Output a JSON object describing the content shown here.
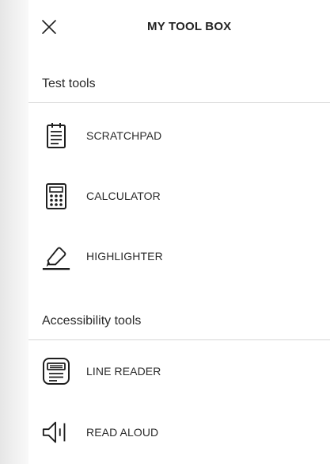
{
  "header": {
    "title": "MY TOOL BOX",
    "close_icon": "close-icon"
  },
  "sections": [
    {
      "heading": "Test tools",
      "items": [
        {
          "label": "SCRATCHPAD",
          "icon": "scratchpad-icon"
        },
        {
          "label": "CALCULATOR",
          "icon": "calculator-icon"
        },
        {
          "label": "HIGHLIGHTER",
          "icon": "highlighter-icon"
        }
      ]
    },
    {
      "heading": "Accessibility tools",
      "items": [
        {
          "label": "LINE READER",
          "icon": "line-reader-icon"
        },
        {
          "label": "READ ALOUD",
          "icon": "read-aloud-icon"
        }
      ]
    }
  ],
  "colors": {
    "icon": "#1f1f1f",
    "divider": "#d6d6d6",
    "background": "#ffffff"
  }
}
